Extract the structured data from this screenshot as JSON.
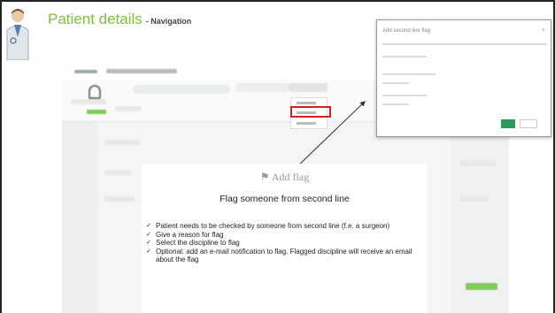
{
  "header": {
    "title": "Patient details",
    "subtitle": "- Navigation"
  },
  "dialog": {
    "title": "Add second line flag",
    "close": "×"
  },
  "card": {
    "heading": "Add flag",
    "flag_icon": "flag-icon",
    "subtitle": "Flag someone from second line",
    "bullets": [
      "Patient needs to be checked by someone from second line (f.e. a surgeon)",
      "Give a reason for flag",
      "Select the discipline to flag",
      "Optional: add an e-mail notification to flag. Flagged discipline will receive an email about the flag"
    ]
  },
  "colors": {
    "title_green": "#7fbf3f",
    "highlight_red": "#d42020",
    "ok_green": "#2b9b5e"
  }
}
